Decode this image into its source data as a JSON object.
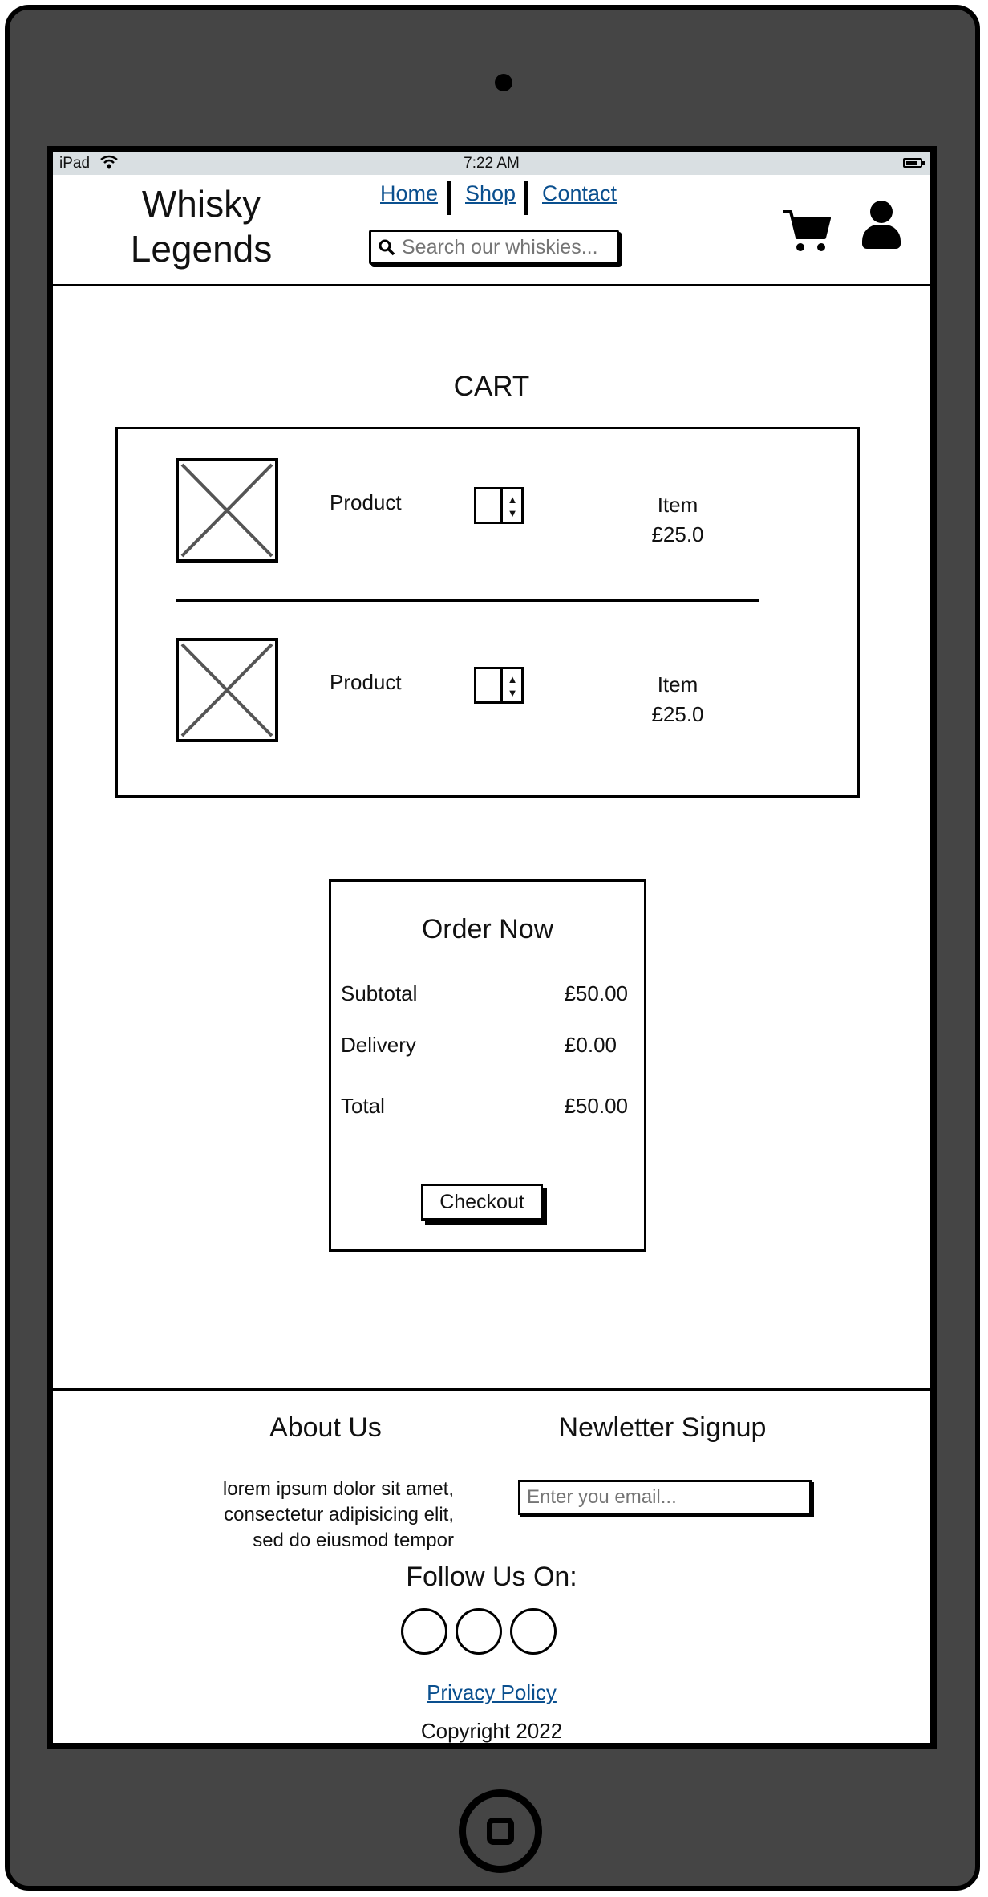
{
  "status_bar": {
    "carrier": "iPad",
    "time": "7:22 AM"
  },
  "header": {
    "logo_line1": "Whisky",
    "logo_line2": "Legends",
    "nav": {
      "home": "Home",
      "shop": "Shop",
      "contact": "Contact"
    },
    "search_placeholder": "Search our whiskies..."
  },
  "cart": {
    "title": "CART",
    "items": [
      {
        "name": "Product",
        "label": "Item",
        "price": "£25.0"
      },
      {
        "name": "Product",
        "label": "Item",
        "price": "£25.0"
      }
    ]
  },
  "order": {
    "title": "Order Now",
    "subtotal_label": "Subtotal",
    "subtotal_value": "£50.00",
    "delivery_label": "Delivery",
    "delivery_value": "£0.00",
    "total_label": "Total",
    "total_value": "£50.00",
    "checkout_label": "Checkout"
  },
  "footer": {
    "about_title": "About Us",
    "about_text_1": "lorem ipsum dolor sit amet,",
    "about_text_2": "consectetur adipisicing elit,",
    "about_text_3": "sed do eiusmod tempor",
    "newsletter_title": "Newletter Signup",
    "email_placeholder": "Enter you email...",
    "follow_title": "Follow Us On:",
    "privacy_label": "Privacy Policy",
    "copyright": "Copyright 2022"
  },
  "icons": {
    "search": "search-icon",
    "cart": "cart-icon",
    "user": "user-icon",
    "image_placeholder": "image-placeholder-icon"
  }
}
